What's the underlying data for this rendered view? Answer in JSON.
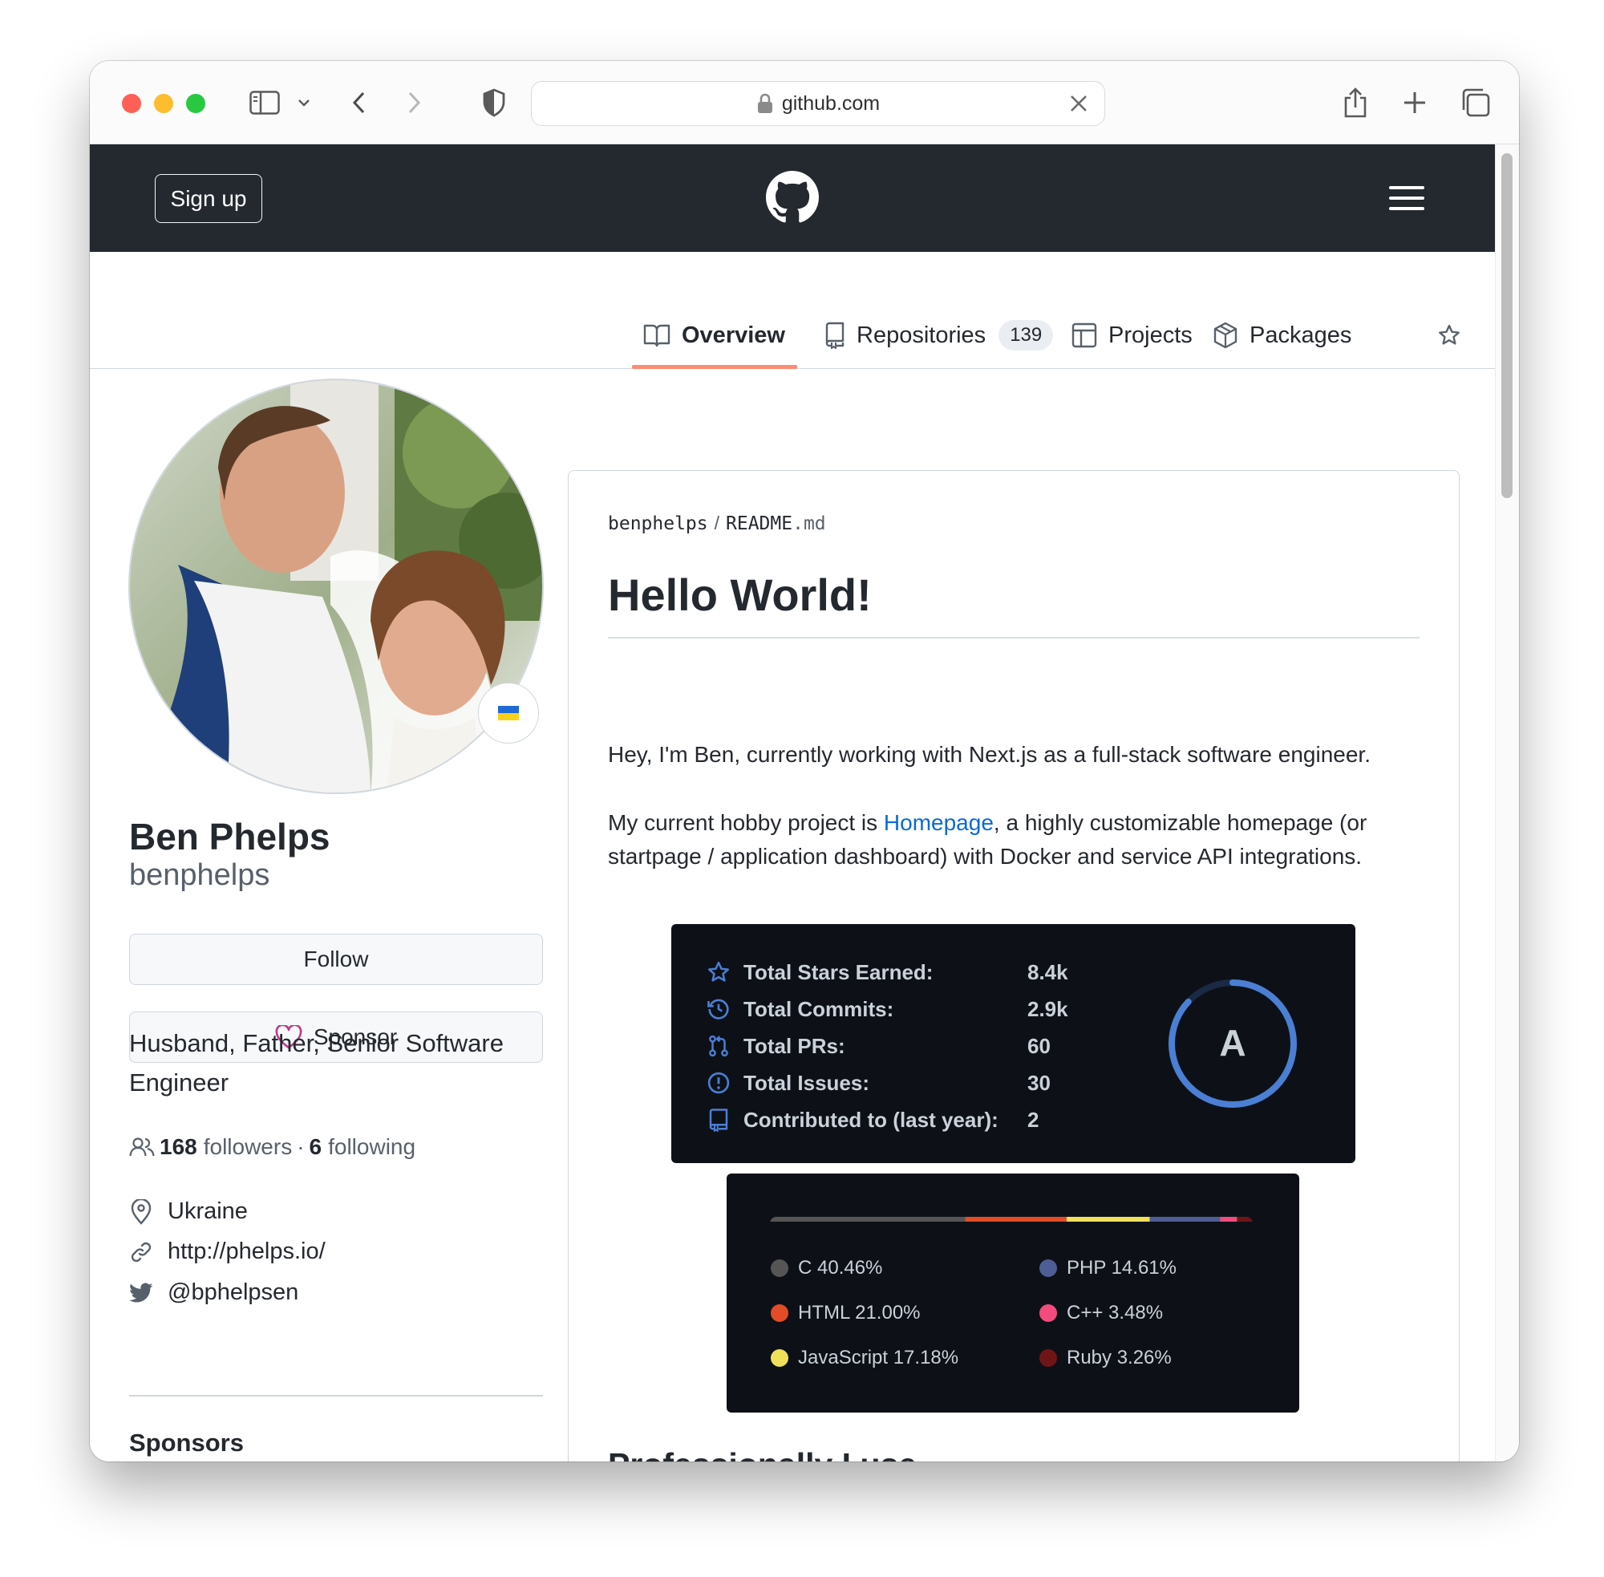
{
  "browser": {
    "url": "github.com",
    "traffic_lights": [
      "#fe5f57",
      "#febc2e",
      "#28c840"
    ]
  },
  "header": {
    "signup_label": "Sign up"
  },
  "tabs": [
    {
      "label": "Overview",
      "icon": "book-icon",
      "active": true
    },
    {
      "label": "Repositories",
      "icon": "repo-icon",
      "count": "139"
    },
    {
      "label": "Projects",
      "icon": "table-icon"
    },
    {
      "label": "Packages",
      "icon": "package-icon"
    }
  ],
  "profile": {
    "status_emoji": "ukraine-flag-icon",
    "name": "Ben Phelps",
    "username": "benphelps",
    "follow_label": "Follow",
    "sponsor_label": "Sponsor",
    "bio": "Husband, Father, Senior Software Engineer",
    "followers_count": "168",
    "followers_label": "followers",
    "dot": "·",
    "following_count": "6",
    "following_label": "following",
    "location": "Ukraine",
    "website": "http://phelps.io/",
    "twitter": "@bphelpsen",
    "sponsors_title": "Sponsors"
  },
  "readme": {
    "owner": "benphelps",
    "slash": "/",
    "file_base": "README",
    "file_ext": ".md",
    "heading": "Hello World!",
    "intro": "Hey, I'm Ben, currently working with Next.js as a full-stack software engineer.",
    "hobby_prefix": "My current hobby project is ",
    "hobby_link": "Homepage",
    "hobby_suffix": ", a highly customizable homepage (or startpage / application dashboard) with Docker and service API integrations.",
    "section2": "Professionally I use,"
  },
  "stats": {
    "rows": [
      {
        "label": "Total Stars Earned:",
        "value": "8.4k",
        "icon": "star-icon"
      },
      {
        "label": "Total Commits:",
        "value": "2.9k",
        "icon": "history-icon"
      },
      {
        "label": "Total PRs:",
        "value": "60",
        "icon": "pull-request-icon"
      },
      {
        "label": "Total Issues:",
        "value": "30",
        "icon": "issue-icon"
      },
      {
        "label": "Contributed to (last year):",
        "value": "2",
        "icon": "repo-icon"
      }
    ],
    "rank": "A",
    "rank_progress": 0.87,
    "accent": "#4a7fd4"
  },
  "languages": [
    {
      "name": "C",
      "percent": 40.46,
      "label": "C 40.46%",
      "color": "#555555"
    },
    {
      "name": "HTML",
      "percent": 21.0,
      "label": "HTML 21.00%",
      "color": "#e34c26"
    },
    {
      "name": "JavaScript",
      "percent": 17.18,
      "label": "JavaScript 17.18%",
      "color": "#f1e05a"
    },
    {
      "name": "PHP",
      "percent": 14.61,
      "label": "PHP 14.61%",
      "color": "#4f5d95"
    },
    {
      "name": "C++",
      "percent": 3.48,
      "label": "C++ 3.48%",
      "color": "#f34b7d"
    },
    {
      "name": "Ruby",
      "percent": 3.26,
      "label": "Ruby 3.26%",
      "color": "#701516"
    }
  ]
}
